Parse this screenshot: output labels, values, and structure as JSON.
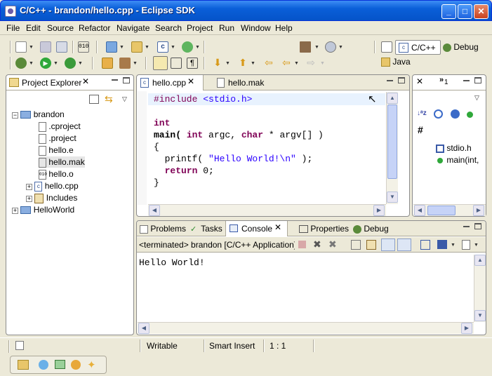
{
  "window": {
    "title": "C/C++ - brandon/hello.cpp - Eclipse SDK",
    "minimize": "_",
    "maximize": "□",
    "close": "✕"
  },
  "menu": [
    "File",
    "Edit",
    "Source",
    "Refactor",
    "Navigate",
    "Search",
    "Project",
    "Run",
    "Window",
    "Help"
  ],
  "perspectives": {
    "cpp": "C/C++",
    "debug": "Debug",
    "java": "Java"
  },
  "project_explorer": {
    "tab": "Project Explorer",
    "items": [
      {
        "label": "brandon",
        "icon": "project-icon"
      },
      {
        "label": ".cproject",
        "icon": "file-icon"
      },
      {
        "label": ".project",
        "icon": "file-icon"
      },
      {
        "label": "hello.e",
        "icon": "file-icon"
      },
      {
        "label": "hello.mak",
        "icon": "file-icon"
      },
      {
        "label": "hello.o",
        "icon": "binary-icon"
      },
      {
        "label": "hello.cpp",
        "icon": "cpp-file-icon"
      },
      {
        "label": "Includes",
        "icon": "includes-icon"
      },
      {
        "label": "HelloWorld",
        "icon": "project-icon"
      }
    ]
  },
  "editor": {
    "tabs": [
      "hello.cpp",
      "hello.mak"
    ],
    "lines": [
      {
        "kw": "#include",
        "rest": " ",
        "str": "<stdio.h>",
        "tail": ""
      },
      {
        "kw": "",
        "rest": "",
        "str": "",
        "tail": ""
      },
      {
        "kw": "int",
        "rest": "",
        "str": "",
        "tail": ""
      },
      {
        "kw": "",
        "rest": "main( ",
        "str": "",
        "tail": ""
      },
      {
        "kw": "",
        "rest": "{",
        "str": "",
        "tail": ""
      },
      {
        "kw": "",
        "rest": "  printf( ",
        "str": "\"Hello World!\\n\"",
        "tail": " );"
      },
      {
        "kw": "",
        "rest": "  ",
        "str": "",
        "tail": ""
      },
      {
        "kw": "",
        "rest": "}",
        "str": "",
        "tail": ""
      }
    ],
    "main_sig": {
      "a": "main( ",
      "int": "int",
      "b": " argc, ",
      "char": "char",
      "c": " * argv[] )"
    },
    "return_line": {
      "kw": "return",
      "rest": " 0;"
    }
  },
  "outline": {
    "tab_count": "1",
    "items": [
      "stdio.h",
      "main(int,"
    ]
  },
  "bottom": {
    "tabs": [
      "Problems",
      "Tasks",
      "Console",
      "Properties",
      "Debug"
    ],
    "console_title": "<terminated> brandon [C/C++ Application] C",
    "output": "Hello World!"
  },
  "status": {
    "mode": "Writable",
    "insert": "Smart Insert",
    "position": "1 : 1"
  },
  "colors": {
    "keyword": "#7f0055",
    "string": "#2a00ff",
    "title_bar": "#0553c9",
    "highlight_line": "#e8f2fe"
  }
}
